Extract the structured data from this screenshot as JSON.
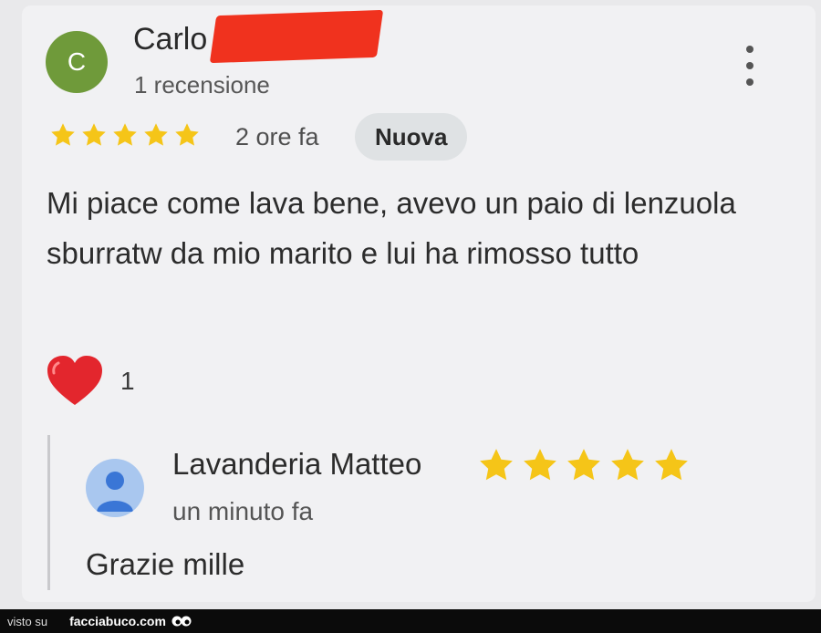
{
  "review": {
    "avatar_letter": "C",
    "author": "Carlo",
    "review_count": "1 recensione",
    "rating": 5,
    "time": "2 ore fa",
    "badge": "Nuova",
    "text": "Mi piace come lava bene, avevo un paio di lenzuola sburratw da mio marito e lui ha rimosso tutto",
    "likes": "1"
  },
  "reply": {
    "author": "Lavanderia Matteo",
    "rating": 5,
    "time": "un minuto fa",
    "text": "Grazie mille"
  },
  "footer": {
    "label": "visto su",
    "site": "facciabuco.com"
  },
  "icons": {
    "menu": "more-vert-icon",
    "star": "star-icon",
    "heart": "heart-icon",
    "owner_avatar": "person-icon"
  },
  "colors": {
    "star": "#f5c518",
    "avatar": "#6f9a3a",
    "heart": "#e3262d",
    "badge_bg": "#dfe2e4",
    "redaction": "#f0321e"
  }
}
